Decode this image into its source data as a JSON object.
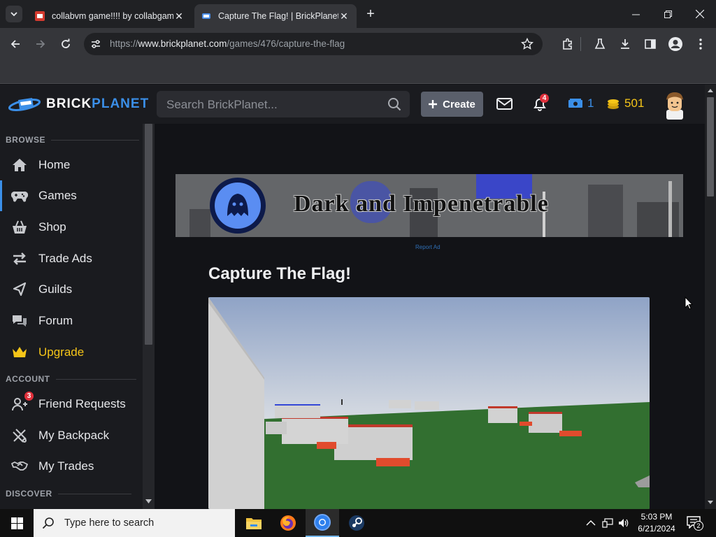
{
  "browser": {
    "tabs": [
      {
        "title": "collabvm game!!!! by collabgam",
        "active": false
      },
      {
        "title": "Capture The Flag! | BrickPlanet",
        "active": true
      }
    ],
    "url_prefix": "https://",
    "url_domain": "www.brickplanet.com",
    "url_path": "/games/476/capture-the-flag"
  },
  "site": {
    "logo_brick": "BRICK",
    "logo_planet": "PLANET",
    "search_placeholder": "Search BrickPlanet...",
    "create_label": "Create",
    "notification_count": "4",
    "credits": "1",
    "bits": "501",
    "colors": {
      "accent": "#3b8fe8",
      "gold": "#f5c518",
      "badge": "#e0303b"
    }
  },
  "sidebar": {
    "browse_header": "BROWSE",
    "account_header": "ACCOUNT",
    "discover_header": "DISCOVER",
    "browse_items": [
      {
        "label": "Home",
        "icon": "home-icon"
      },
      {
        "label": "Games",
        "icon": "gamepad-icon"
      },
      {
        "label": "Shop",
        "icon": "basket-icon"
      },
      {
        "label": "Trade Ads",
        "icon": "exchange-icon"
      },
      {
        "label": "Guilds",
        "icon": "flag-icon"
      },
      {
        "label": "Forum",
        "icon": "chat-icon"
      },
      {
        "label": "Upgrade",
        "icon": "crown-icon"
      }
    ],
    "account_items": [
      {
        "label": "Friend Requests",
        "icon": "friends-icon",
        "badge": "3"
      },
      {
        "label": "My Backpack",
        "icon": "backpack-icon"
      },
      {
        "label": "My Trades",
        "icon": "handshake-icon"
      }
    ]
  },
  "main": {
    "banner_text": "Dark and Impenetrable",
    "report_ad": "Report Ad",
    "game_title": "Capture The Flag!"
  },
  "taskbar": {
    "search_placeholder": "Type here to search",
    "time": "5:03 PM",
    "date": "6/21/2024",
    "notification_count": "2"
  }
}
